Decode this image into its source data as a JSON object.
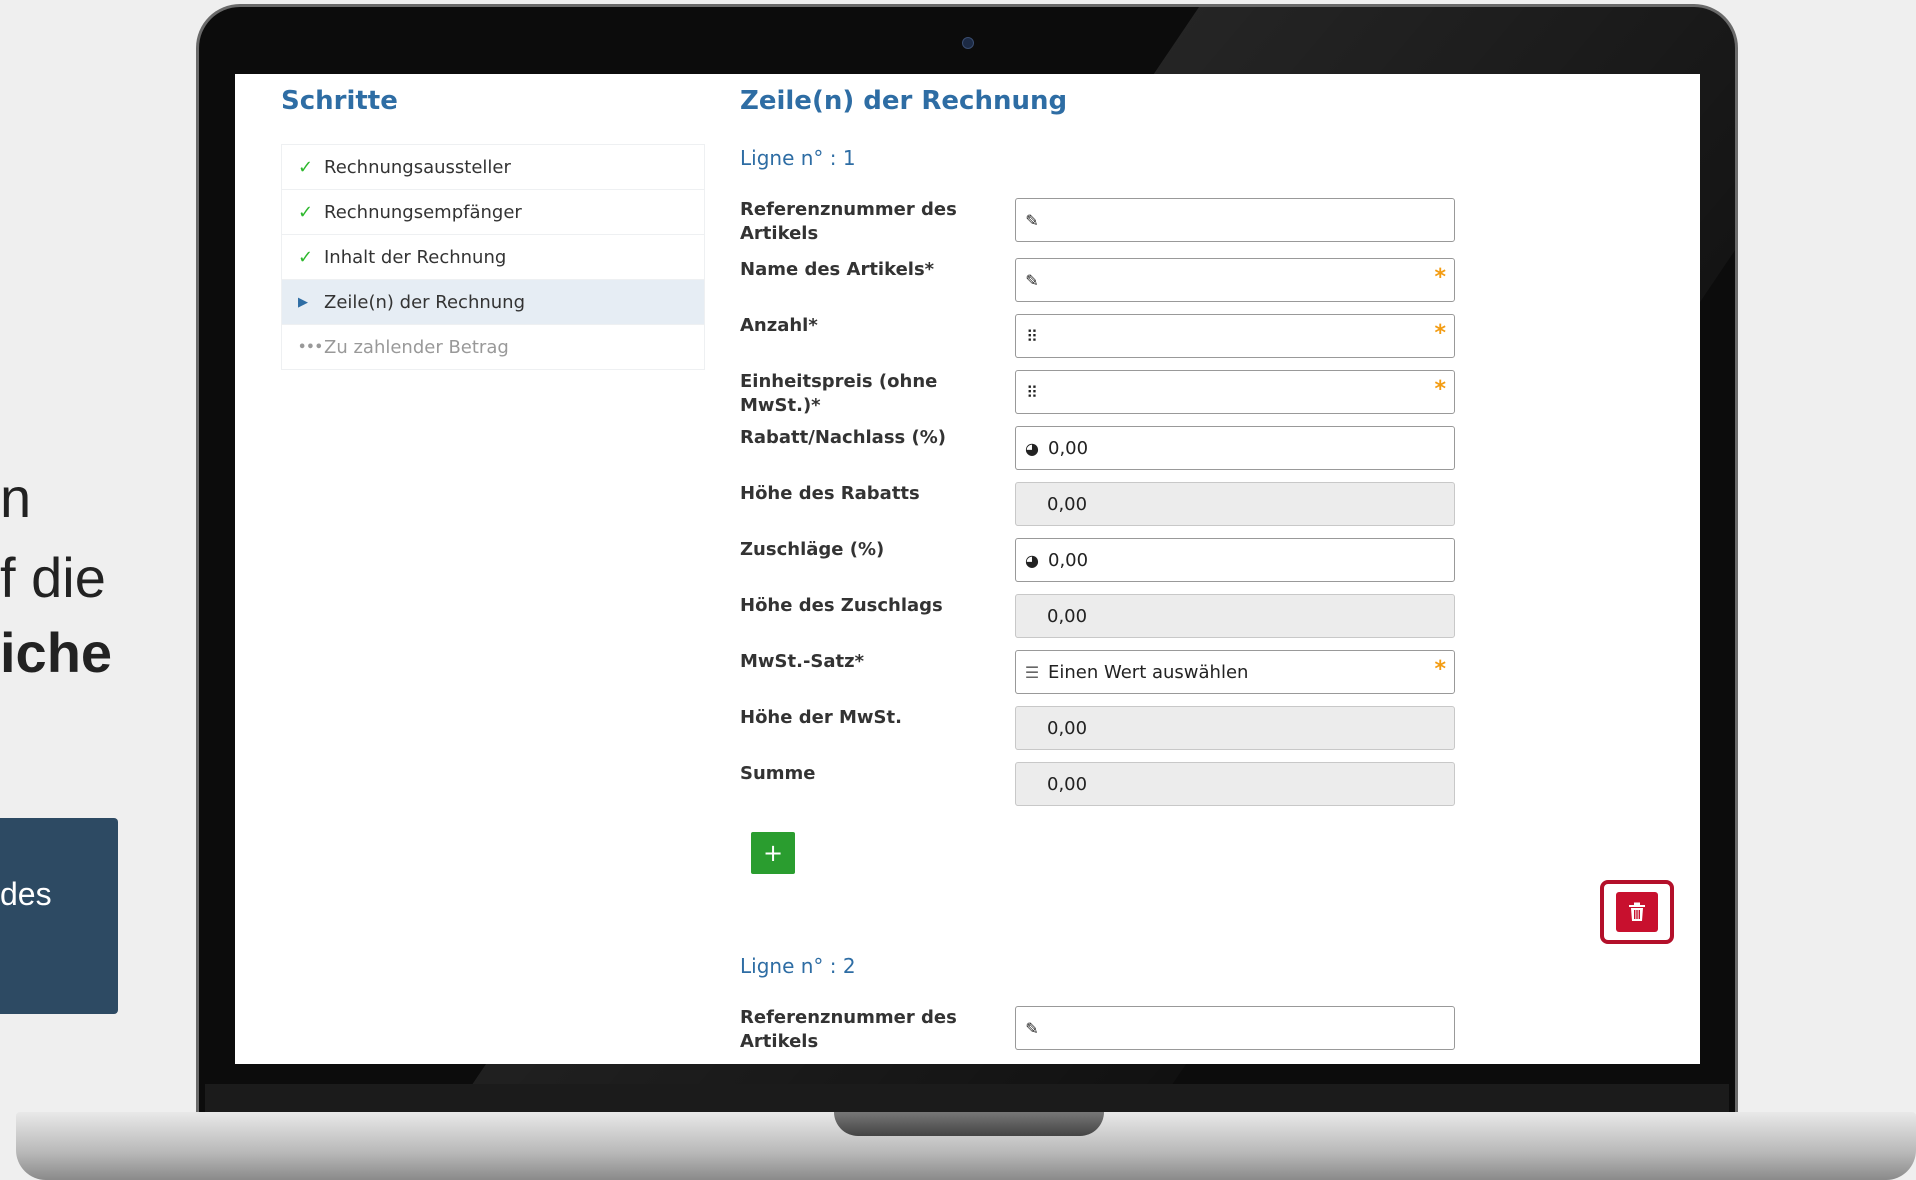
{
  "background": {
    "text_line1": "n",
    "text_line2": "f die",
    "text_line3": "iche",
    "box_text": "des"
  },
  "sidebar": {
    "title": "Schritte",
    "steps": [
      {
        "label": "Rechnungsaussteller",
        "mark": "✓",
        "state": "done"
      },
      {
        "label": "Rechnungsempfänger",
        "mark": "✓",
        "state": "done"
      },
      {
        "label": "Inhalt der Rechnung",
        "mark": "✓",
        "state": "done"
      },
      {
        "label": "Zeile(n) der Rechnung",
        "mark": "▶",
        "state": "active"
      },
      {
        "label": "Zu zahlender Betrag",
        "mark": "•••",
        "state": "pending"
      }
    ]
  },
  "main": {
    "title": "Zeile(n) der Rechnung",
    "line1": {
      "title": "Ligne n° : 1",
      "fields": {
        "ref": {
          "label": "Referenznummer des Artikels",
          "value": ""
        },
        "name": {
          "label": "Name des Artikels*",
          "value": ""
        },
        "qty": {
          "label": "Anzahl*",
          "value": ""
        },
        "unit_price": {
          "label": "Einheitspreis (ohne MwSt.)*",
          "value": ""
        },
        "discount_pct": {
          "label": "Rabatt/Nachlass (%)",
          "value": "0,00"
        },
        "discount_amt": {
          "label": "Höhe des Rabatts",
          "value": "0,00"
        },
        "surcharge_pct": {
          "label": "Zuschläge (%)",
          "value": "0,00"
        },
        "surcharge_amt": {
          "label": "Höhe des Zuschlags",
          "value": "0,00"
        },
        "vat_rate": {
          "label": "MwSt.-Satz*",
          "value": "Einen Wert auswählen"
        },
        "vat_amt": {
          "label": "Höhe der MwSt.",
          "value": "0,00"
        },
        "total": {
          "label": "Summe",
          "value": "0,00"
        }
      }
    },
    "line2": {
      "title": "Ligne n° : 2",
      "ref": {
        "label": "Referenznummer des Artikels",
        "value": ""
      }
    },
    "add_button": "+",
    "required_mark": "*"
  },
  "colors": {
    "accent": "#2e6da4",
    "required": "#f39c12",
    "add": "#2a9d2f",
    "delete": "#c8102e"
  }
}
